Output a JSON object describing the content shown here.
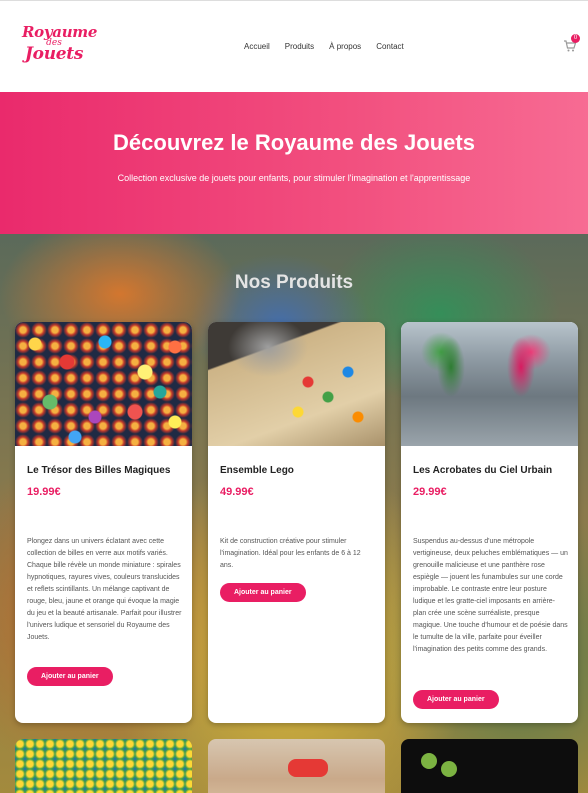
{
  "header": {
    "logo": {
      "line1": "Royaume",
      "line2": "des",
      "line3": "Jouets"
    },
    "nav": [
      "Accueil",
      "Produits",
      "À propos",
      "Contact"
    ],
    "cart_count": "0"
  },
  "hero": {
    "title": "Découvrez le Royaume des Jouets",
    "subtitle": "Collection exclusive de jouets pour enfants, pour stimuler l'imagination et l'apprentissage"
  },
  "products": {
    "heading": "Nos Produits",
    "items": [
      {
        "title": "Le Trésor des Billes Magiques",
        "price": "19.99€",
        "description": "Plongez dans un univers éclatant avec cette collection de billes en verre aux motifs variés. Chaque bille révèle un monde miniature : spirales hypnotiques, rayures vives, couleurs translucides et reflets scintillants. Un mélange captivant de rouge, bleu, jaune et orange qui évoque la magie du jeu et la beauté artisanale. Parfait pour illustrer l'univers ludique et sensoriel du Royaume des Jouets.",
        "button": "Ajouter au panier"
      },
      {
        "title": "Ensemble Lego",
        "price": "49.99€",
        "description": "Kit de construction créative pour stimuler l'imagination. Idéal pour les enfants de 6 à 12 ans.",
        "button": "Ajouter au panier"
      },
      {
        "title": "Les Acrobates du Ciel Urbain",
        "price": "29.99€",
        "description": "Suspendus au-dessus d'une métropole vertigineuse, deux peluches emblématiques — un grenouille malicieuse et une panthère rose espiègle — jouent les funambules sur une corde improbable. Le contraste entre leur posture ludique et les gratte-ciel imposants en arrière-plan crée une scène surréaliste, presque magique. Une touche d'humour et de poésie dans le tumulte de la ville, parfaite pour éveiller l'imagination des petits comme des grands.",
        "button": "Ajouter au panier"
      }
    ]
  },
  "colors": {
    "brand": "#e91e63",
    "hero_start": "#ea2a6c",
    "hero_end": "#f76b93"
  }
}
